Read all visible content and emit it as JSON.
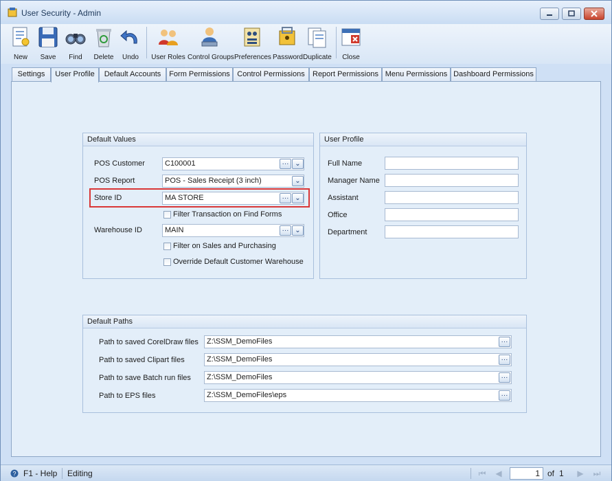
{
  "window": {
    "title": "User Security - Admin"
  },
  "toolbar": {
    "items": [
      {
        "label": "New",
        "icon": "new-document-icon"
      },
      {
        "label": "Save",
        "icon": "floppy-disk-icon"
      },
      {
        "label": "Find",
        "icon": "binoculars-icon"
      },
      {
        "label": "Delete",
        "icon": "recycle-bin-icon"
      },
      {
        "label": "Undo",
        "icon": "undo-arrow-icon"
      },
      {
        "label": "User Roles",
        "icon": "user-roles-icon"
      },
      {
        "label": "Control Groups",
        "icon": "control-groups-icon"
      },
      {
        "label": "Preferences",
        "icon": "preferences-icon"
      },
      {
        "label": "Password",
        "icon": "password-lock-icon"
      },
      {
        "label": "Duplicate",
        "icon": "duplicate-pages-icon"
      },
      {
        "label": "Close",
        "icon": "close-window-icon"
      }
    ]
  },
  "tabs": [
    {
      "label": "Settings"
    },
    {
      "label": "User Profile",
      "active": true
    },
    {
      "label": "Default Accounts"
    },
    {
      "label": "Form Permissions"
    },
    {
      "label": "Control Permissions"
    },
    {
      "label": "Report Permissions"
    },
    {
      "label": "Menu Permissions"
    },
    {
      "label": "Dashboard Permissions"
    }
  ],
  "default_values": {
    "title": "Default Values",
    "pos_customer": {
      "label": "POS Customer",
      "value": "C100001"
    },
    "pos_report": {
      "label": "POS Report",
      "value": "POS - Sales Receipt (3 inch)"
    },
    "store_id": {
      "label": "Store ID",
      "value": "MA STORE"
    },
    "filter_find": {
      "label": "Filter Transaction on Find Forms",
      "checked": false
    },
    "warehouse_id": {
      "label": "Warehouse ID",
      "value": "MAIN"
    },
    "filter_sales": {
      "label": "Filter on Sales and Purchasing",
      "checked": false
    },
    "override_wh": {
      "label": "Override Default Customer Warehouse",
      "checked": false
    }
  },
  "user_profile": {
    "title": "User Profile",
    "full_name": {
      "label": "Full Name",
      "value": ""
    },
    "manager_name": {
      "label": "Manager Name",
      "value": ""
    },
    "assistant": {
      "label": "Assistant",
      "value": ""
    },
    "office": {
      "label": "Office",
      "value": ""
    },
    "department": {
      "label": "Department",
      "value": ""
    }
  },
  "default_paths": {
    "title": "Default Paths",
    "coreldraw": {
      "label": "Path to saved CorelDraw files",
      "value": "Z:\\SSM_DemoFiles"
    },
    "clipart": {
      "label": "Path to saved Clipart files",
      "value": "Z:\\SSM_DemoFiles"
    },
    "batch": {
      "label": "Path to save Batch run files",
      "value": "Z:\\SSM_DemoFiles"
    },
    "eps": {
      "label": "Path to EPS files",
      "value": "Z:\\SSM_DemoFiles\\eps"
    }
  },
  "status": {
    "help": "F1 - Help",
    "mode": "Editing",
    "page": "1",
    "of_label": "of",
    "total": "1"
  },
  "colors": {
    "highlight": "#d93636",
    "panel": "#e3eef9",
    "accent": "#1e395b"
  }
}
